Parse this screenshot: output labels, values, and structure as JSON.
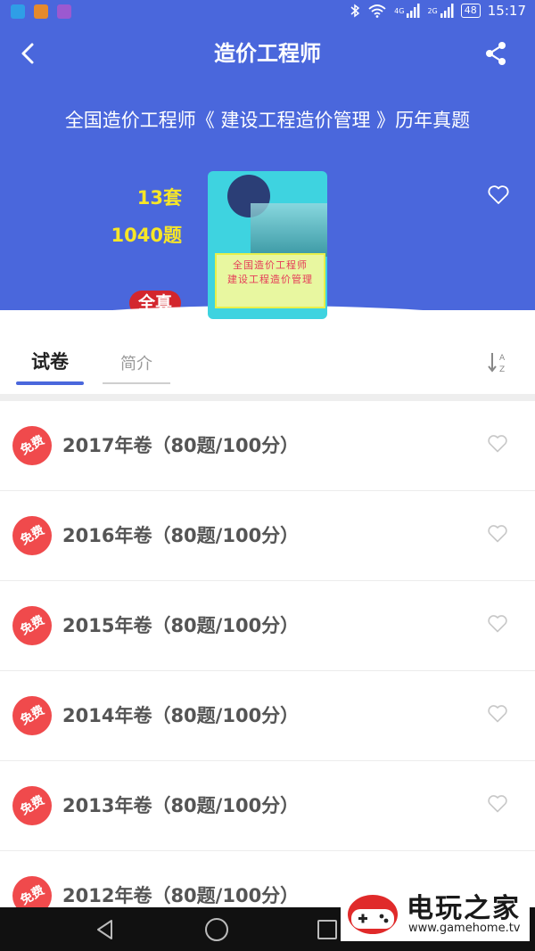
{
  "status_bar": {
    "network_4g": "4G",
    "network_2g": "2G",
    "battery": "48",
    "time": "15:17"
  },
  "header": {
    "title": "造价工程师",
    "subtitle": "全国造价工程师《 建设工程造价管理 》历年真题",
    "sets_count": "13套",
    "questions_count": "1040题",
    "badge": "全真",
    "cover_line1": "全国造价工程师",
    "cover_line2": "建设工程造价管理"
  },
  "tabs": [
    {
      "label": "试卷",
      "active": true
    },
    {
      "label": "简介",
      "active": false
    }
  ],
  "papers": [
    {
      "badge": "免费",
      "title": "2017年卷（80题/100分）"
    },
    {
      "badge": "免费",
      "title": "2016年卷（80题/100分）"
    },
    {
      "badge": "免费",
      "title": "2015年卷（80题/100分）"
    },
    {
      "badge": "免费",
      "title": "2014年卷（80题/100分）"
    },
    {
      "badge": "免费",
      "title": "2013年卷（80题/100分）"
    },
    {
      "badge": "免费",
      "title": "2012年卷（80题/100分）"
    }
  ],
  "watermark": {
    "brand": "电玩之家",
    "url": "www.gamehome.tv"
  },
  "colors": {
    "primary": "#4a67dc",
    "highlight": "#f7e627",
    "badge_red": "#d3262d",
    "free_red": "#f04a4c"
  }
}
